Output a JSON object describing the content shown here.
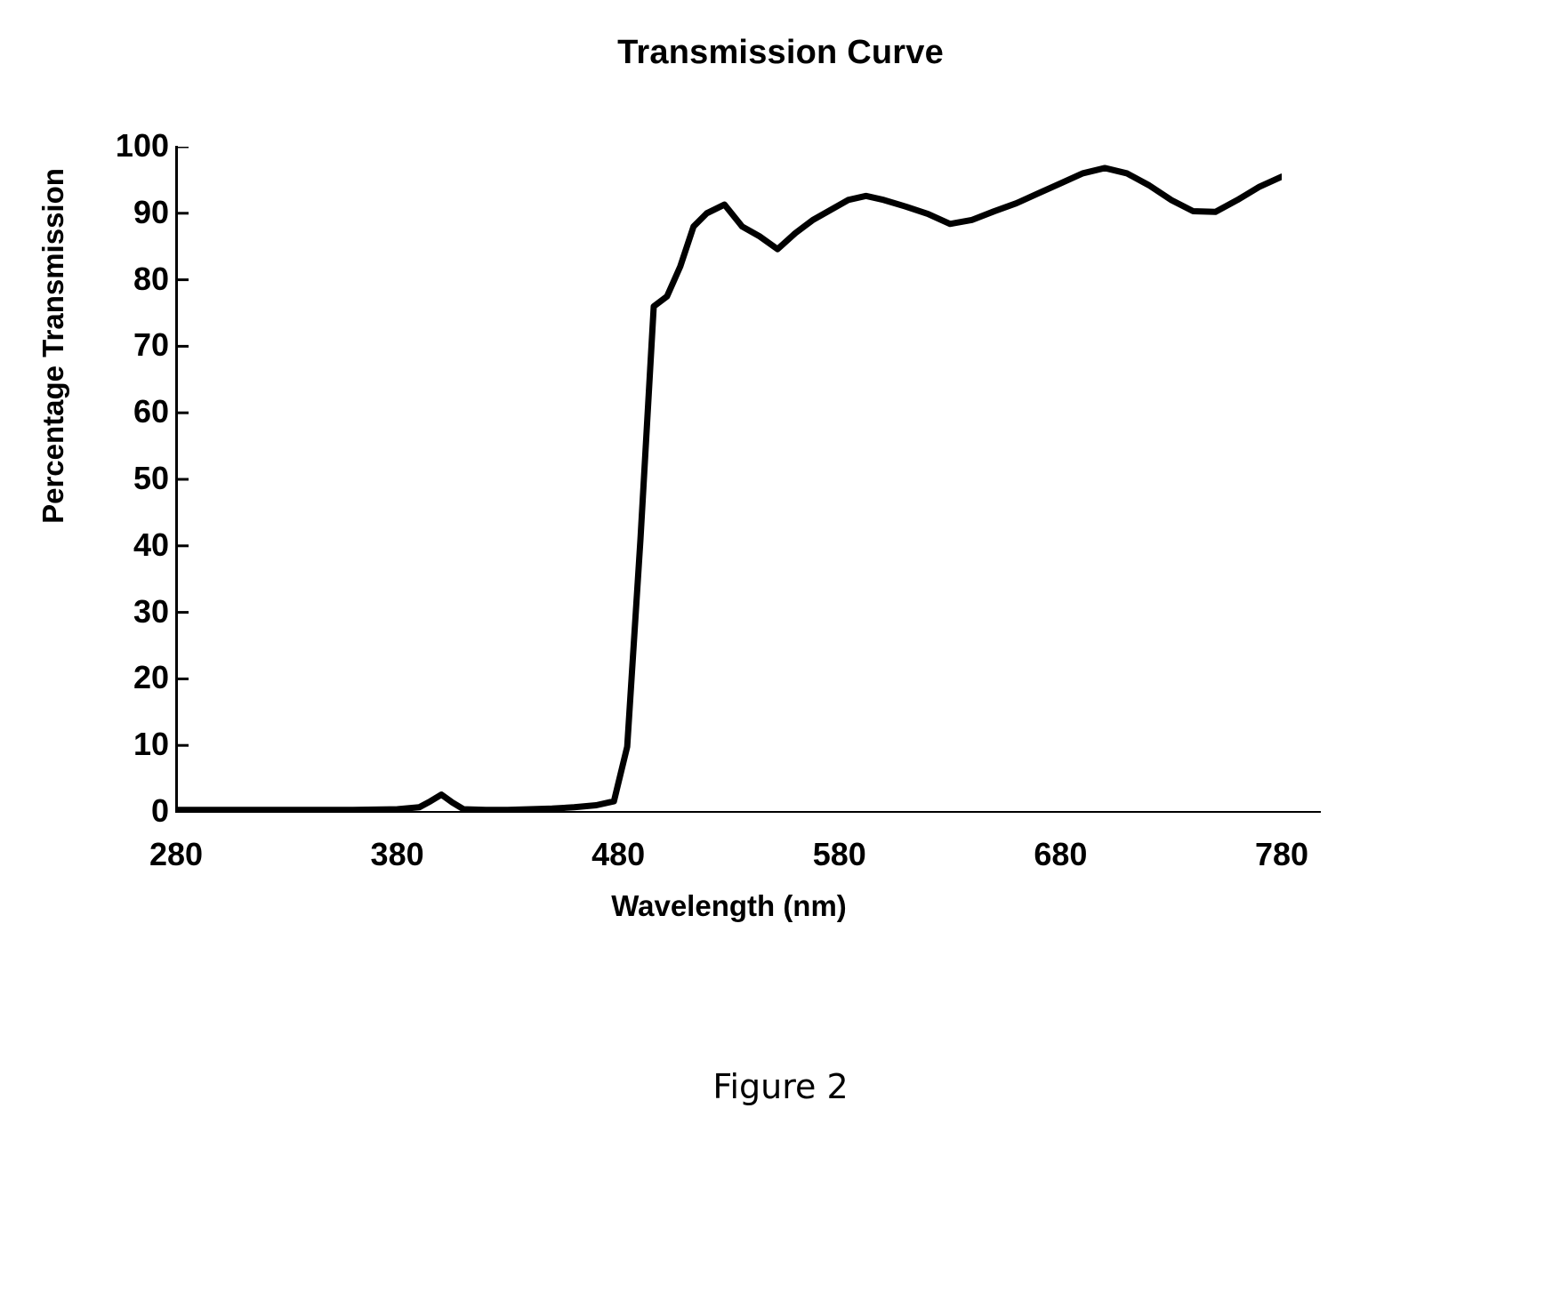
{
  "figure": {
    "caption": "Figure 2"
  },
  "chart_data": {
    "type": "line",
    "title": "Transmission Curve",
    "xlabel": "Wavelength (nm)",
    "ylabel": "Percentage Transmission",
    "xlim": [
      280,
      780
    ],
    "ylim": [
      0,
      100
    ],
    "grid": false,
    "legend": null,
    "line_color": "#000000",
    "line_width": 7,
    "xticks": [
      280,
      380,
      480,
      580,
      680,
      780
    ],
    "xtick_labels": [
      "280",
      "380",
      "480",
      "580",
      "680",
      "780"
    ],
    "yticks": [
      0,
      10,
      20,
      30,
      40,
      50,
      60,
      70,
      80,
      90,
      100
    ],
    "ytick_labels": [
      "0",
      "10",
      "20",
      "30",
      "40",
      "50",
      "60",
      "70",
      "80",
      "90",
      "100"
    ],
    "series": [
      {
        "name": "Transmission",
        "x": [
          280,
          300,
          320,
          340,
          360,
          380,
          390,
          395,
          400,
          405,
          410,
          420,
          430,
          440,
          450,
          460,
          470,
          478,
          484,
          490,
          496,
          502,
          508,
          514,
          520,
          528,
          536,
          544,
          552,
          560,
          568,
          576,
          584,
          592,
          600,
          610,
          620,
          630,
          640,
          650,
          660,
          670,
          680,
          690,
          700,
          710,
          720,
          730,
          740,
          750,
          760,
          770,
          780
        ],
        "y": [
          0.3,
          0.3,
          0.3,
          0.3,
          0.3,
          0.4,
          0.7,
          1.6,
          2.6,
          1.4,
          0.4,
          0.3,
          0.3,
          0.4,
          0.5,
          0.7,
          1.0,
          1.6,
          9.8,
          41.0,
          76.0,
          77.5,
          82.0,
          88.0,
          90.0,
          91.3,
          88.0,
          86.5,
          84.6,
          87.0,
          89.0,
          90.5,
          92.0,
          92.6,
          92.0,
          91.0,
          89.9,
          88.4,
          89.0,
          90.3,
          91.5,
          93.0,
          94.5,
          96.0,
          96.8,
          96.0,
          94.2,
          92.0,
          90.3,
          90.2,
          92.0,
          94.0,
          95.5
        ]
      }
    ]
  }
}
